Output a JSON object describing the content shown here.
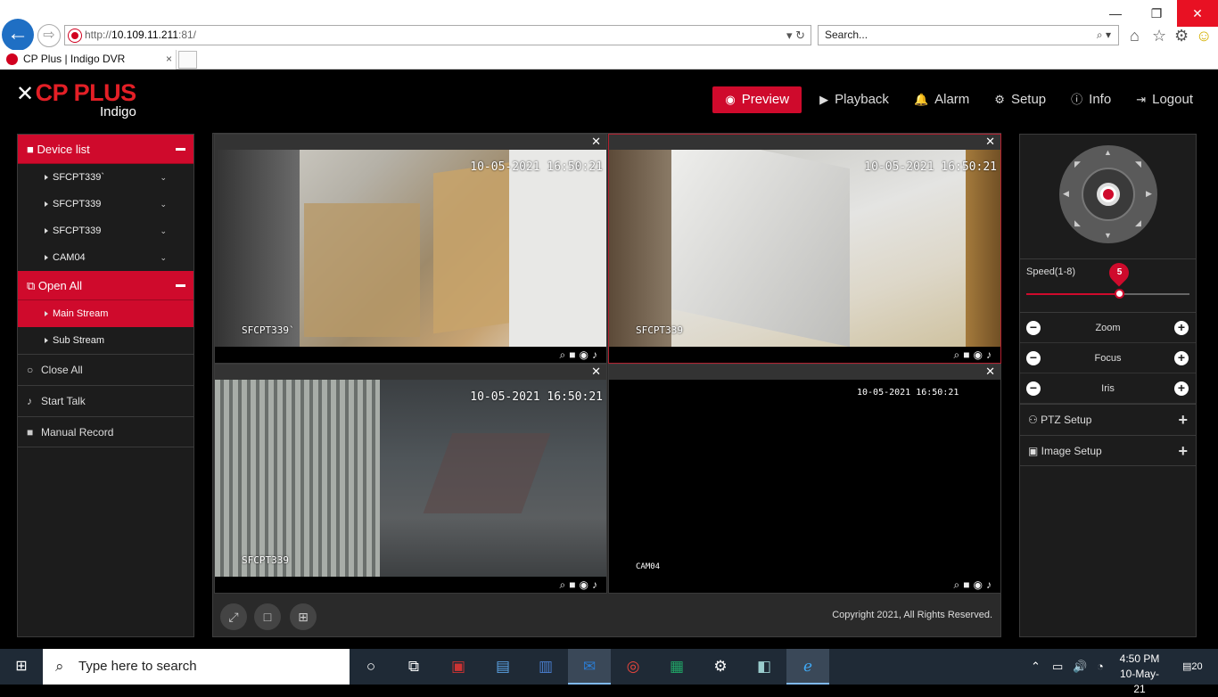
{
  "browser": {
    "url_prefix": "http://",
    "url_host": "10.109.11.211",
    "url_suffix": ":81/",
    "search_placeholder": "Search...",
    "tab_title": "CP Plus | Indigo DVR",
    "tab_close": "×",
    "window_minimize": "—",
    "window_restore": "❐",
    "window_close": "✕"
  },
  "brand": {
    "name": "CP PLUS",
    "product": "Indigo",
    "color": "#e31f26"
  },
  "topnav": [
    {
      "label": "Preview",
      "icon": "eye-icon",
      "active": true
    },
    {
      "label": "Playback",
      "icon": "play-circle-icon"
    },
    {
      "label": "Alarm",
      "icon": "bell-icon"
    },
    {
      "label": "Setup",
      "icon": "gear-icon"
    },
    {
      "label": "Info",
      "icon": "info-icon"
    },
    {
      "label": "Logout",
      "icon": "logout-icon"
    }
  ],
  "left_panel": {
    "device_list": "Device list",
    "devices": [
      "SFCPT339`",
      "SFCPT339",
      "SFCPT339",
      "CAM04"
    ],
    "open_all": "Open All",
    "streams": [
      "Main Stream",
      "Sub Stream"
    ],
    "close_all": "Close All",
    "start_talk": "Start Talk",
    "manual_record": "Manual Record"
  },
  "video": {
    "cells": [
      {
        "timestamp": "10-05-2021 16:50:21",
        "name": "SFCPT339`"
      },
      {
        "timestamp": "10-05-2021 16:50:21",
        "name": "SFCPT339"
      },
      {
        "timestamp": "10-05-2021 16:50:21",
        "name": "SFCPT339"
      },
      {
        "timestamp": "10-05-2021 16:50:21",
        "name": "CAM04"
      }
    ],
    "close_glyph": "✕",
    "cell_tools": "⌕■◉♪",
    "copyright": "Copyright 2021, All Rights Reserved."
  },
  "right_panel": {
    "speed_label": "Speed(1-8)",
    "speed_value": "5",
    "speed_fraction": 0.571,
    "zoom": "Zoom",
    "focus": "Focus",
    "iris": "Iris",
    "ptz_setup": "PTZ Setup",
    "image_setup": "Image Setup"
  },
  "taskbar": {
    "search_placeholder": "Type here to search",
    "time": "4:50 PM",
    "date": "10-May-21",
    "notifications": "20"
  }
}
